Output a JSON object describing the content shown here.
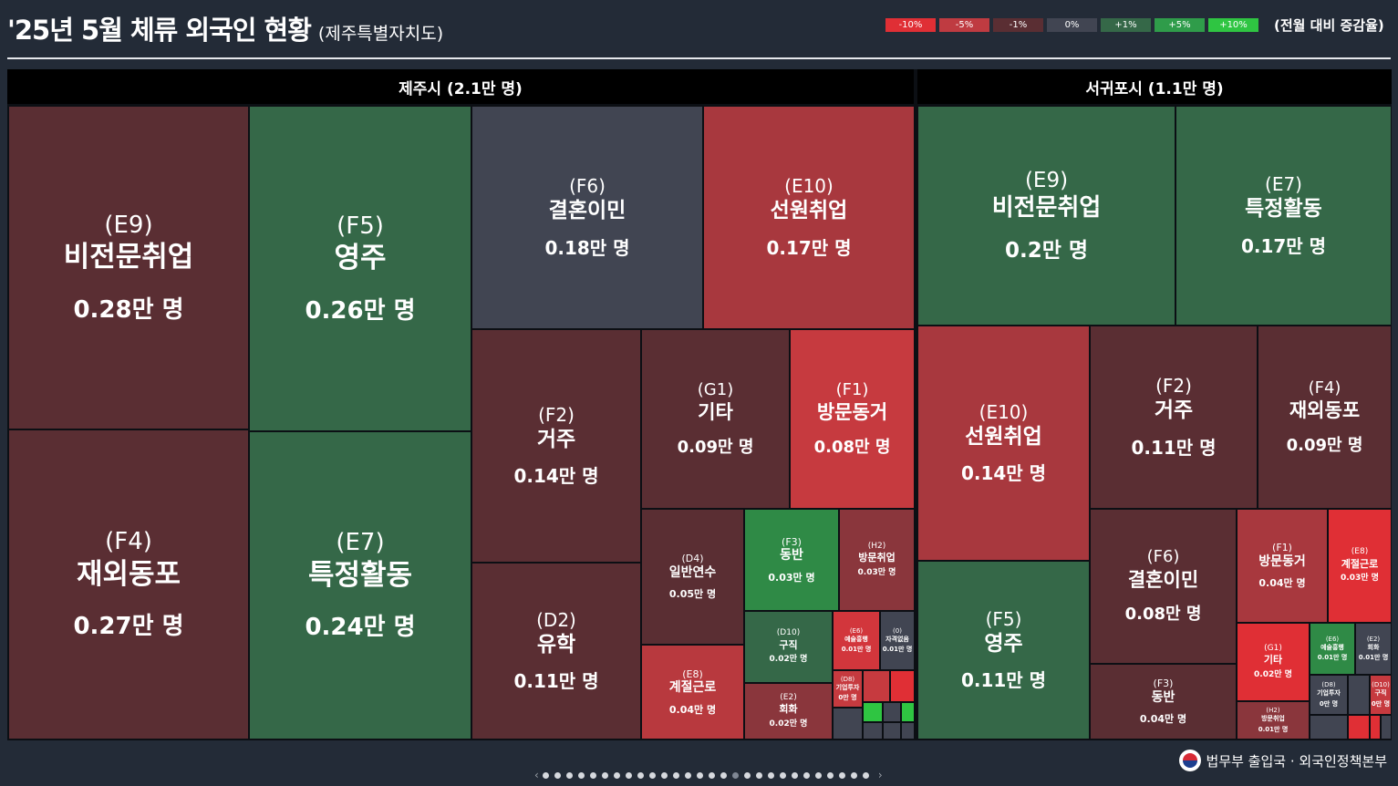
{
  "header": {
    "title": "'25년 5월 체류 외국인 현황",
    "subtitle": "(제주특별자치도)"
  },
  "legend": {
    "items": [
      {
        "label": "-10%",
        "color": "#e02f35"
      },
      {
        "label": "-5%",
        "color": "#bf3b41"
      },
      {
        "label": "-1%",
        "color": "#5a2e33"
      },
      {
        "label": "0%",
        "color": "#414552"
      },
      {
        "label": "+1%",
        "color": "#356848"
      },
      {
        "label": "+5%",
        "color": "#2f9c4a"
      },
      {
        "label": "+10%",
        "color": "#2fc542"
      }
    ],
    "caption": "(전월 대비 증감율)"
  },
  "regions": {
    "jeju": {
      "title": "제주시 (2.1만 명)"
    },
    "seogwipo": {
      "title": "서귀포시 (1.1만 명)"
    }
  },
  "cells": [
    {
      "id": "jeju-e9",
      "code": "(E9)",
      "name": "비전문취업",
      "value": "0.28만 명",
      "color": "#5a2e33"
    },
    {
      "id": "jeju-f4",
      "code": "(F4)",
      "name": "재외동포",
      "value": "0.27만 명",
      "color": "#5a2e33"
    },
    {
      "id": "jeju-f5",
      "code": "(F5)",
      "name": "영주",
      "value": "0.26만 명",
      "color": "#356848"
    },
    {
      "id": "jeju-e7",
      "code": "(E7)",
      "name": "특정활동",
      "value": "0.24만 명",
      "color": "#356848"
    },
    {
      "id": "jeju-f6",
      "code": "(F6)",
      "name": "결혼이민",
      "value": "0.18만 명",
      "color": "#414552"
    },
    {
      "id": "jeju-e10",
      "code": "(E10)",
      "name": "선원취업",
      "value": "0.17만 명",
      "color": "#a8383e"
    },
    {
      "id": "jeju-f2",
      "code": "(F2)",
      "name": "거주",
      "value": "0.14만 명",
      "color": "#5a2e33"
    },
    {
      "id": "jeju-d2",
      "code": "(D2)",
      "name": "유학",
      "value": "0.11만 명",
      "color": "#5a2e33"
    },
    {
      "id": "jeju-g1",
      "code": "(G1)",
      "name": "기타",
      "value": "0.09만 명",
      "color": "#5a2e33"
    },
    {
      "id": "jeju-f1",
      "code": "(F1)",
      "name": "방문동거",
      "value": "0.08만 명",
      "color": "#c63a3f"
    },
    {
      "id": "jeju-d4",
      "code": "(D4)",
      "name": "일반연수",
      "value": "0.05만 명",
      "color": "#5a2e33"
    },
    {
      "id": "jeju-f3",
      "code": "(F3)",
      "name": "동반",
      "value": "0.03만 명",
      "color": "#2f8a46"
    },
    {
      "id": "jeju-h2",
      "code": "(H2)",
      "name": "방문취업",
      "value": "0.03만 명",
      "color": "#8a363c"
    },
    {
      "id": "jeju-e8",
      "code": "(E8)",
      "name": "계절근로",
      "value": "0.04만 명",
      "color": "#b8393e"
    },
    {
      "id": "jeju-d10",
      "code": "(D10)",
      "name": "구직",
      "value": "0.02만 명",
      "color": "#356848"
    },
    {
      "id": "jeju-e6",
      "code": "(E6)",
      "name": "예술흥행",
      "value": "0.01만 명",
      "color": "#d2363c"
    },
    {
      "id": "jeju-0",
      "code": "(0)",
      "name": "자격없음",
      "value": "0.01만 명",
      "color": "#414552"
    },
    {
      "id": "jeju-e2",
      "code": "(E2)",
      "name": "회화",
      "value": "0.02만 명",
      "color": "#8a363c"
    },
    {
      "id": "jeju-d8",
      "code": "(D8)",
      "name": "기업투자",
      "value": "0만 명",
      "color": "#c63a3f"
    },
    {
      "id": "seo-e9",
      "code": "(E9)",
      "name": "비전문취업",
      "value": "0.2만 명",
      "color": "#356848"
    },
    {
      "id": "seo-e7",
      "code": "(E7)",
      "name": "특정활동",
      "value": "0.17만 명",
      "color": "#356848"
    },
    {
      "id": "seo-e10",
      "code": "(E10)",
      "name": "선원취업",
      "value": "0.14만 명",
      "color": "#a8383e"
    },
    {
      "id": "seo-f5",
      "code": "(F5)",
      "name": "영주",
      "value": "0.11만 명",
      "color": "#356848"
    },
    {
      "id": "seo-f2",
      "code": "(F2)",
      "name": "거주",
      "value": "0.11만 명",
      "color": "#5a2e33"
    },
    {
      "id": "seo-f4",
      "code": "(F4)",
      "name": "재외동포",
      "value": "0.09만 명",
      "color": "#5a2e33"
    },
    {
      "id": "seo-f6",
      "code": "(F6)",
      "name": "결혼이민",
      "value": "0.08만 명",
      "color": "#5a2e33"
    },
    {
      "id": "seo-f3",
      "code": "(F3)",
      "name": "동반",
      "value": "0.04만 명",
      "color": "#5a2e33"
    },
    {
      "id": "seo-f1",
      "code": "(F1)",
      "name": "방문동거",
      "value": "0.04만 명",
      "color": "#a8383e"
    },
    {
      "id": "seo-e8",
      "code": "(E8)",
      "name": "계절근로",
      "value": "0.03만 명",
      "color": "#e02f35"
    },
    {
      "id": "seo-g1",
      "code": "(G1)",
      "name": "기타",
      "value": "0.02만 명",
      "color": "#e02f35"
    },
    {
      "id": "seo-e6",
      "code": "(E6)",
      "name": "예술흥행",
      "value": "0.01만 명",
      "color": "#2f8a46"
    },
    {
      "id": "seo-e2",
      "code": "(E2)",
      "name": "회화",
      "value": "0.01만 명",
      "color": "#414552"
    },
    {
      "id": "seo-d8",
      "code": "(D8)",
      "name": "기업투자",
      "value": "0만 명",
      "color": "#414552"
    },
    {
      "id": "seo-d10",
      "code": "(D10)",
      "name": "구직",
      "value": "0만 명",
      "color": "#c63a3f"
    },
    {
      "id": "seo-h2",
      "code": "(H2)",
      "name": "방문취업",
      "value": "0.01만 명",
      "color": "#8a363c"
    }
  ],
  "tiny_cells": [
    {
      "color": "#c63a3f"
    },
    {
      "color": "#e02f35"
    },
    {
      "color": "#2fc542"
    },
    {
      "color": "#414552"
    },
    {
      "color": "#414552"
    },
    {
      "color": "#414552"
    },
    {
      "color": "#2fc542"
    },
    {
      "color": "#414552"
    },
    {
      "color": "#414552"
    },
    {
      "color": "#414552"
    },
    {
      "color": "#414552"
    },
    {
      "color": "#e02f35"
    },
    {
      "color": "#e02f35"
    },
    {
      "color": "#414552"
    }
  ],
  "footer": {
    "org": "법무부 출입국 · 외국인정책본부",
    "emblem_icon": "taegeuk-emblem-icon"
  },
  "pager": {
    "pages": 28,
    "active": 16
  }
}
